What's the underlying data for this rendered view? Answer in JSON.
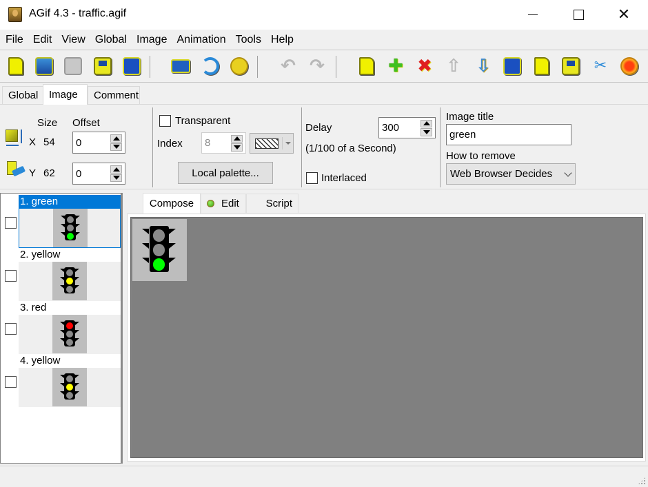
{
  "window": {
    "title": "AGif 4.3 - traffic.agif",
    "controls": [
      "minimize",
      "maximize",
      "close"
    ]
  },
  "menu": [
    "File",
    "Edit",
    "View",
    "Global",
    "Image",
    "Animation",
    "Tools",
    "Help"
  ],
  "toolbar": {
    "groups": [
      [
        "new-file",
        "open-file",
        "import (disabled)",
        "save",
        "export"
      ],
      [
        "capture-video",
        "reload",
        "optimize"
      ],
      [
        "undo (disabled)",
        "redo (disabled)"
      ],
      [
        "add-frame",
        "insert-frame",
        "delete-frame",
        "move-up (disabled)",
        "move-down",
        "import-image",
        "duplicate-frame",
        "extract-frames",
        "cut-paste",
        "preview"
      ]
    ]
  },
  "props_tabs": {
    "items": [
      "Global",
      "Image",
      "Comment"
    ],
    "active": "Image"
  },
  "image_props": {
    "size_label": "Size",
    "offset_label": "Offset",
    "x_label": "X",
    "x_size": "54",
    "x_offset": "0",
    "y_label": "Y",
    "y_size": "62",
    "y_offset": "0",
    "transparent_label": "Transparent",
    "transparent_checked": false,
    "index_label": "Index",
    "index_value": "8",
    "local_palette_button": "Local palette...",
    "delay_label": "Delay",
    "delay_value": "300",
    "delay_unit": "(1/100 of a Second)",
    "interlaced_label": "Interlaced",
    "interlaced_checked": false,
    "image_title_label": "Image title",
    "image_title_value": "green",
    "how_to_remove_label": "How to remove",
    "how_to_remove_value": "Web Browser Decides"
  },
  "frames": [
    {
      "label": "1. green",
      "light": "green",
      "selected": true,
      "checked": false
    },
    {
      "label": "2. yellow",
      "light": "yellow",
      "selected": false,
      "checked": false
    },
    {
      "label": "3. red",
      "light": "red",
      "selected": false,
      "checked": false
    },
    {
      "label": "4. yellow",
      "light": "yellow",
      "selected": false,
      "checked": false
    }
  ],
  "compose_tabs": {
    "items": [
      "Compose",
      "Edit",
      "Script"
    ],
    "active": "Compose"
  },
  "colors": {
    "selection": "#0078d7",
    "canvas_bg": "#808080",
    "thumb_bg": "#bdbdbd",
    "green": "#00ff00",
    "yellow": "#ffff00",
    "red": "#ff0000",
    "lamp_off": "#8a8a8a"
  }
}
